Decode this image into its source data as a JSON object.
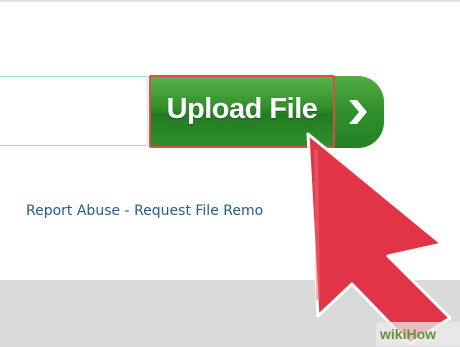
{
  "upload": {
    "button_label": "Upload File",
    "next_icon": "chevron-right-icon"
  },
  "links": {
    "report_abuse": "Report Abuse",
    "separator": " - ",
    "request_removal": "Request File Remo"
  },
  "cursor": {
    "icon": "arrow-cursor-icon",
    "color": "#e23447"
  },
  "watermark": {
    "part1": "wiki",
    "part2": "How"
  },
  "colors": {
    "button_green": "#2f8f2a",
    "button_border": "#e24a4a",
    "link_blue": "#255c8a",
    "field_border": "#a9d3de"
  }
}
